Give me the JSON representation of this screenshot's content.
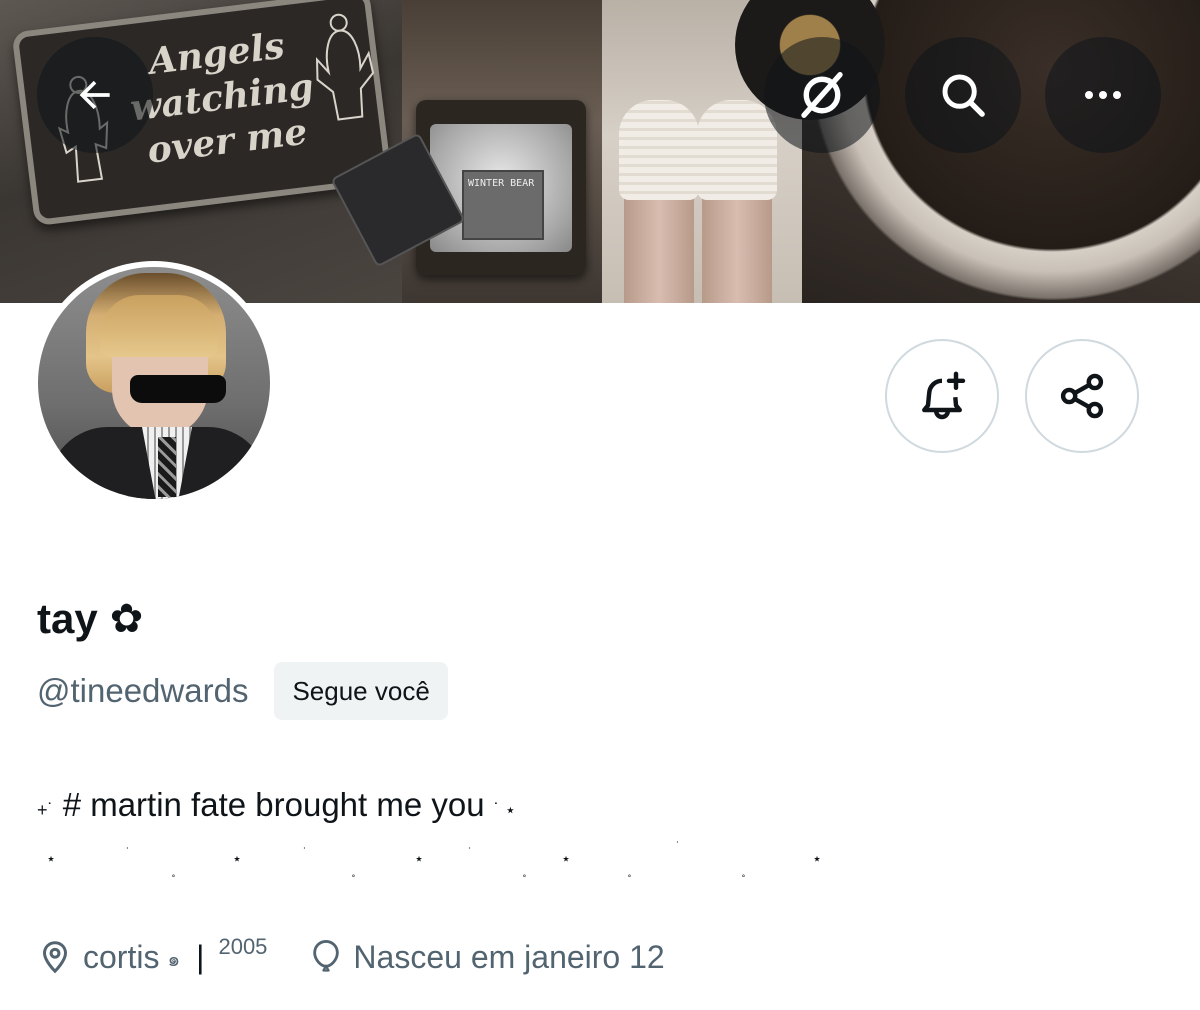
{
  "header": {
    "back_icon": "arrow-left-icon",
    "grok_icon": "grok-icon",
    "search_icon": "search-icon",
    "more_icon": "more-horizontal-icon"
  },
  "banner": {
    "plaque_line1": "Angels",
    "plaque_line2": "watching",
    "plaque_line3": "over me",
    "tv_sign": "WINTER BEAR"
  },
  "profile": {
    "display_name": "tay",
    "name_emoji": "✿",
    "handle": "@tineedwards",
    "follows_you_badge": "Segue você",
    "bio_prefix": "+˙",
    "bio_text": "# martin fate brought me you",
    "bio_suffix": "˙ ⋆"
  },
  "meta": {
    "location": "cortis",
    "location_symbol": "๑",
    "separator": "|",
    "year": "2005",
    "birthday": "Nasceu em janeiro 12"
  },
  "actions": {
    "notify_icon": "bell-plus-icon",
    "share_icon": "share-icon"
  },
  "colors": {
    "primary_text": "#0f1419",
    "secondary_text": "#536471",
    "border": "#cfd9de",
    "badge_bg": "#eff3f4"
  }
}
